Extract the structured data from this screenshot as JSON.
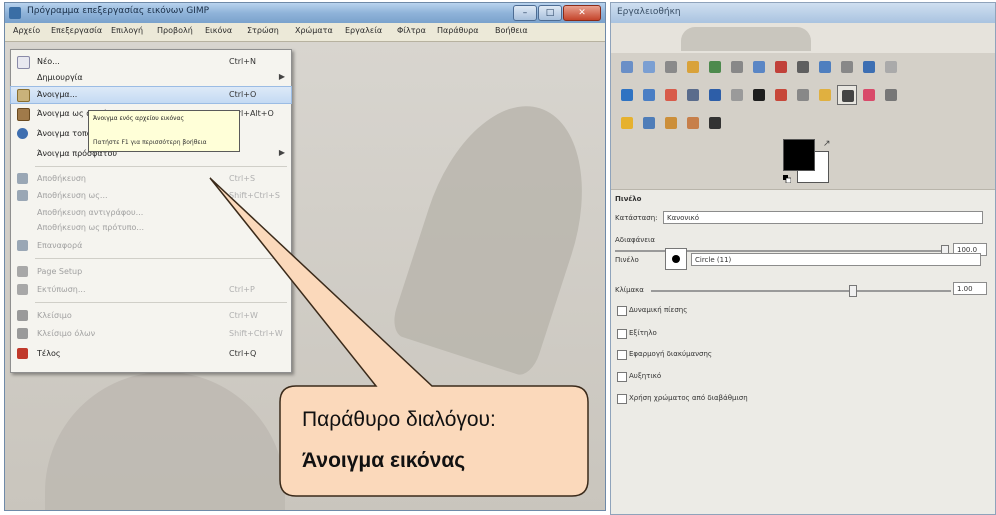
{
  "main_window": {
    "title": "Πρόγραμμα επεξεργασίας εικόνων GIMP",
    "menubar": [
      "Αρχείο",
      "Επεξεργασία",
      "Επιλογή",
      "Προβολή",
      "Εικόνα",
      "Στρώση",
      "Χρώματα",
      "Εργαλεία",
      "Φίλτρα",
      "Παράθυρα",
      "Βοήθεια"
    ],
    "controls": {
      "minimize": "–",
      "maximize": "□",
      "close": "✕"
    }
  },
  "file_menu": {
    "items": [
      {
        "label": "Νέο...",
        "shortcut": "Ctrl+N",
        "icon": "new-file-icon",
        "state": "normal"
      },
      {
        "label": "Δημιουργία",
        "shortcut": "",
        "icon": "",
        "state": "submenu"
      },
      {
        "label": "Άνοιγμα...",
        "shortcut": "Ctrl+O",
        "icon": "open-folder-icon",
        "state": "highlighted"
      },
      {
        "label": "Άνοιγμα ως στρώσεις...",
        "shortcut": "Ctrl+Alt+O",
        "icon": "open-layers-icon",
        "state": "normal"
      },
      {
        "label": "Άνοιγμα τοποθεσίας...",
        "shortcut": "",
        "icon": "globe-icon",
        "state": "normal"
      },
      {
        "label": "Άνοιγμα πρόσφατου",
        "shortcut": "",
        "icon": "",
        "state": "submenu"
      },
      {
        "label": "Αποθήκευση",
        "shortcut": "Ctrl+S",
        "icon": "save-icon",
        "state": "disabled"
      },
      {
        "label": "Αποθήκευση ως...",
        "shortcut": "Shift+Ctrl+S",
        "icon": "save-as-icon",
        "state": "disabled"
      },
      {
        "label": "Αποθήκευση αντιγράφου...",
        "shortcut": "",
        "icon": "",
        "state": "disabled"
      },
      {
        "label": "Αποθήκευση ως πρότυπο...",
        "shortcut": "",
        "icon": "",
        "state": "disabled"
      },
      {
        "label": "Επαναφορά",
        "shortcut": "",
        "icon": "revert-icon",
        "state": "disabled"
      },
      {
        "label": "Page Setup",
        "shortcut": "",
        "icon": "page-setup-icon",
        "state": "disabled"
      },
      {
        "label": "Εκτύπωση...",
        "shortcut": "Ctrl+P",
        "icon": "print-icon",
        "state": "disabled"
      },
      {
        "label": "Κλείσιμο",
        "shortcut": "Ctrl+W",
        "icon": "close-icon",
        "state": "disabled"
      },
      {
        "label": "Κλείσιμο όλων",
        "shortcut": "Shift+Ctrl+W",
        "icon": "close-all-icon",
        "state": "disabled"
      },
      {
        "label": "Τέλος",
        "shortcut": "Ctrl+Q",
        "icon": "quit-icon",
        "state": "normal"
      }
    ]
  },
  "tooltip": {
    "line1": "Άνοιγμα ενός αρχείου εικόνας",
    "line2": "Πατήστε F1 για περισσότερη βοήθεια"
  },
  "callout": {
    "line1": "Παράθυρο διαλόγου:",
    "line2": "Άνοιγμα εικόνας"
  },
  "toolbox": {
    "title": "Εργαλειοθήκη",
    "tool_icons": [
      "rect-select-icon",
      "ellipse-select-icon",
      "lasso-icon",
      "fuzzy-select-icon",
      "color-select-icon",
      "scissors-icon",
      "foreground-select-icon",
      "paths-icon",
      "color-picker-icon",
      "zoom-icon",
      "measure-icon",
      "move-icon",
      "align-icon",
      "crop-icon",
      "rotate-icon",
      "scale-icon",
      "shear-icon",
      "perspective-icon",
      "flip-icon",
      "text-icon",
      "bucket-fill-icon",
      "blend-icon",
      "pencil-icon",
      "paintbrush-icon",
      "eraser-icon",
      "airbrush-icon",
      "ink-icon",
      "clone-icon",
      "heal-icon",
      "blur-icon",
      "smudge-icon"
    ],
    "selected_tool": "paintbrush-icon",
    "colors": {
      "foreground": "#000000",
      "background": "#ffffff"
    },
    "options": {
      "title": "Πινέλο",
      "mode_label": "Κατάσταση:",
      "mode_value": "Κανονικό",
      "opacity_label": "Αδιαφάνεια",
      "opacity_value": "100.0",
      "brush_label": "Πινέλο",
      "brush_name": "Circle (11)",
      "scale_label": "Κλίμακα",
      "scale_value": "1.00",
      "checks": [
        "Δυναμική πίεσης",
        "Εξίτηλο",
        "Εφαρμογή διακύμανσης",
        "Αυξητικό",
        "Χρήση χρώματος από διαβάθμιση"
      ]
    }
  }
}
